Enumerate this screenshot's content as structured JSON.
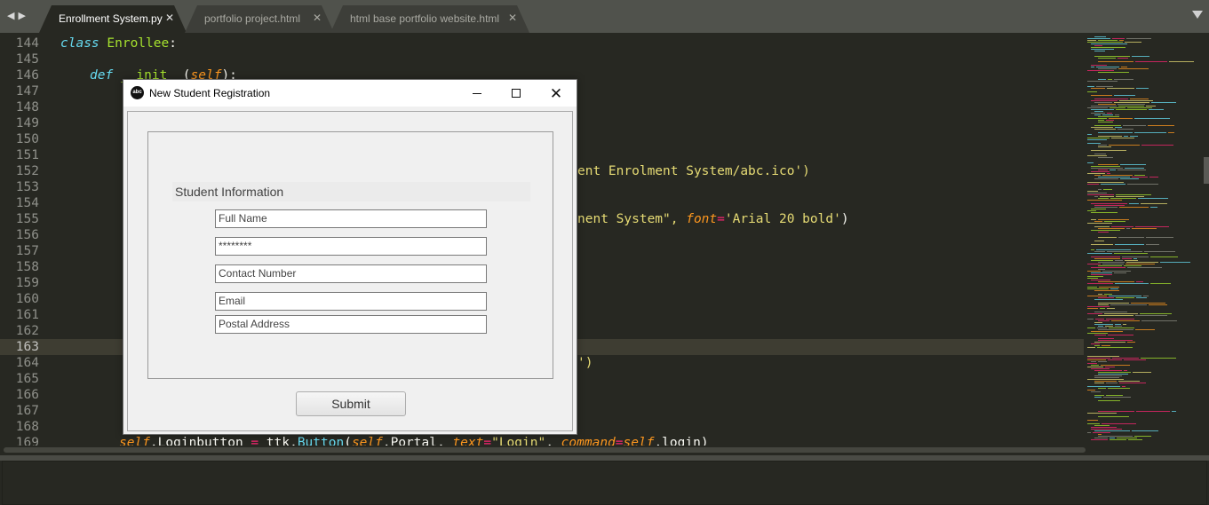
{
  "tabs": [
    {
      "label": "Enrollment System.py",
      "active": true
    },
    {
      "label": "portfolio project.html",
      "active": false
    },
    {
      "label": "html base portfolio website.html",
      "active": false
    }
  ],
  "tab_close_glyph": "✕",
  "nav": {
    "back_icon": "◀",
    "forward_icon": "▶"
  },
  "editor": {
    "current_line": "163",
    "lines": [
      {
        "n": "144"
      },
      {
        "n": "145"
      },
      {
        "n": "146"
      },
      {
        "n": "147"
      },
      {
        "n": "148"
      },
      {
        "n": "149"
      },
      {
        "n": "150"
      },
      {
        "n": "151"
      },
      {
        "n": "152"
      },
      {
        "n": "153"
      },
      {
        "n": "154"
      },
      {
        "n": "155"
      },
      {
        "n": "156"
      },
      {
        "n": "157"
      },
      {
        "n": "158"
      },
      {
        "n": "159"
      },
      {
        "n": "160"
      },
      {
        "n": "161"
      },
      {
        "n": "162"
      },
      {
        "n": "163"
      },
      {
        "n": "164"
      },
      {
        "n": "165"
      },
      {
        "n": "166"
      },
      {
        "n": "167"
      },
      {
        "n": "168"
      },
      {
        "n": "169"
      }
    ],
    "code": {
      "l144_kw": "class",
      "l144_name": "Enrollee",
      "l144_colon": ":",
      "l146_def": "def",
      "l146_fn": "__init__",
      "l146_open": "(",
      "l146_self": "self",
      "l146_close": "):",
      "l152_visible": "ent Enrolment System/abc.ico')",
      "l155_a": "nent System\", ",
      "l155_arg": "font",
      "l155_eq": "=",
      "l155_str": "'Arial 20 bold'",
      "l155_close": ")",
      "l164_visible": "')",
      "l169_self": "self",
      "l169_a": ".Loginbutton ",
      "l169_eq": "=",
      "l169_b": " ttk.",
      "l169_btn": "Button",
      "l169_c": "(",
      "l169_self2": "self",
      "l169_d": ".Portal, ",
      "l169_text": "text",
      "l169_eq2": "=",
      "l169_str": "\"Login\"",
      "l169_e": ", ",
      "l169_cmd": "command",
      "l169_eq3": "=",
      "l169_self3": "self",
      "l169_f": ".login)"
    }
  },
  "dialog": {
    "title": "New Student Registration",
    "app_icon_text": "abc",
    "section_title": "Student Information",
    "fields": {
      "full_name": "Full Name",
      "password": "********",
      "contact": "Contact Number",
      "email": "Email",
      "address": "Postal Address"
    },
    "submit_label": "Submit",
    "close_glyph": "✕"
  },
  "colors": {
    "editor_bg": "#272822",
    "keyword": "#66d9ef",
    "class_name": "#a6e22e",
    "string": "#e6db74",
    "self": "#fd971f",
    "operator": "#f92672"
  }
}
